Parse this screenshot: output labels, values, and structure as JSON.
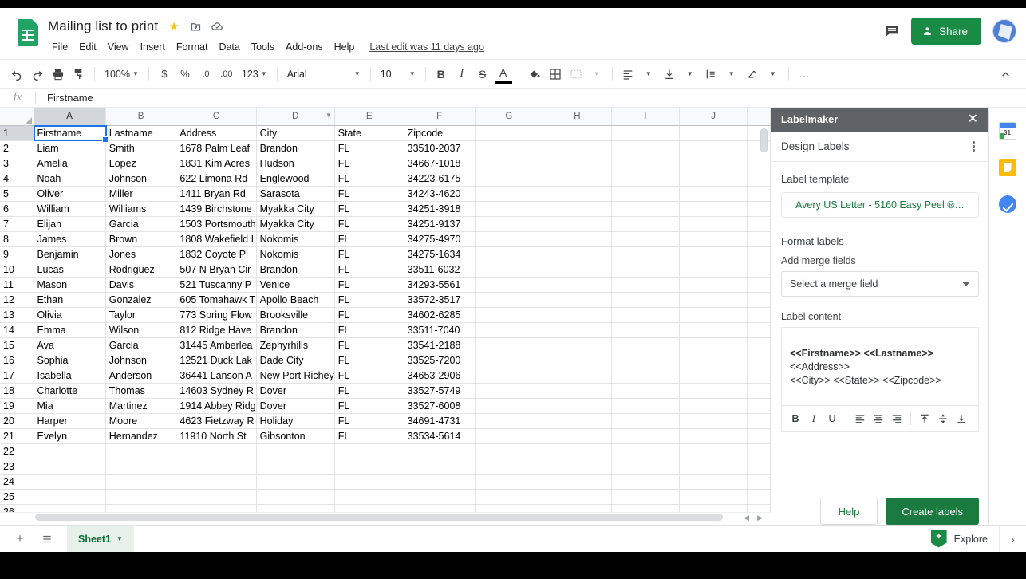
{
  "document": {
    "title": "Mailing list to print",
    "star_icon": "star-icon",
    "move_icon": "move-to-folder-icon",
    "cloud_icon": "cloud-saved-icon",
    "last_edit": "Last edit was 11 days ago"
  },
  "menubar": {
    "items": [
      "File",
      "Edit",
      "View",
      "Insert",
      "Format",
      "Data",
      "Tools",
      "Add-ons",
      "Help"
    ]
  },
  "header_right": {
    "comment_icon": "comment-icon",
    "share_label": "Share",
    "share_icon": "share-person-icon",
    "avatar": "user-avatar"
  },
  "toolbar": {
    "undo": "undo-icon",
    "redo": "redo-icon",
    "print": "print-icon",
    "paint": "paint-format-icon",
    "zoom_value": "100%",
    "currency": "$",
    "percent": "%",
    "decimal_decrease": ".0",
    "decimal_increase": ".00",
    "number_format": "123",
    "font_family": "Arial",
    "font_size": "10",
    "bold": "B",
    "italic": "I",
    "strikethrough": "S",
    "text_color": "A",
    "fill_color": "fill-color-icon",
    "borders": "borders-icon",
    "merge_cells": "merge-cells-icon",
    "halign": "horizontal-align-icon",
    "valign": "vertical-align-icon",
    "text_wrap": "text-wrapping-icon",
    "text_rotation": "text-rotation-icon",
    "more": "…",
    "collapse": "collapse-toolbar-icon"
  },
  "formula_bar": {
    "fx_label": "fx",
    "value": "Firstname"
  },
  "spreadsheet": {
    "selected_cell": "A1",
    "column_headers": [
      "A",
      "B",
      "C",
      "D",
      "E",
      "F",
      "G",
      "H",
      "I",
      "J"
    ],
    "header_row": [
      "Firstname",
      "Lastname",
      "Address",
      "City",
      "State",
      "Zipcode"
    ],
    "rows": [
      {
        "n": "2",
        "cells": [
          "Liam",
          "Smith",
          "1678 Palm Leaf",
          "Brandon",
          "FL",
          "33510-2037"
        ]
      },
      {
        "n": "3",
        "cells": [
          "Amelia",
          "Lopez",
          "1831 Kim Acres",
          "Hudson",
          "FL",
          "34667-1018"
        ]
      },
      {
        "n": "4",
        "cells": [
          "Noah",
          "Johnson",
          "622 Limona Rd",
          "Englewood",
          "FL",
          "34223-6175"
        ]
      },
      {
        "n": "5",
        "cells": [
          "Oliver",
          "Miller",
          "1411 Bryan Rd",
          "Sarasota",
          "FL",
          "34243-4620"
        ]
      },
      {
        "n": "6",
        "cells": [
          "William",
          "Williams",
          "1439 Birchstone",
          "Myakka City",
          "FL",
          "34251-3918"
        ]
      },
      {
        "n": "7",
        "cells": [
          "Elijah",
          "Garcia",
          "1503 Portsmouth",
          "Myakka City",
          "FL",
          "34251-9137"
        ]
      },
      {
        "n": "8",
        "cells": [
          "James",
          "Brown",
          "1808 Wakefield I",
          "Nokomis",
          "FL",
          "34275-4970"
        ]
      },
      {
        "n": "9",
        "cells": [
          "Benjamin",
          "Jones",
          "1832 Coyote Pl",
          "Nokomis",
          "FL",
          "34275-1634"
        ]
      },
      {
        "n": "10",
        "cells": [
          "Lucas",
          "Rodriguez",
          "507 N Bryan Cir",
          "Brandon",
          "FL",
          "33511-6032"
        ]
      },
      {
        "n": "11",
        "cells": [
          "Mason",
          "Davis",
          "521 Tuscanny P",
          "Venice",
          "FL",
          "34293-5561"
        ]
      },
      {
        "n": "12",
        "cells": [
          "Ethan",
          "Gonzalez",
          "605 Tomahawk T",
          "Apollo Beach",
          "FL",
          "33572-3517"
        ]
      },
      {
        "n": "13",
        "cells": [
          "Olivia",
          "Taylor",
          "773 Spring Flow",
          "Brooksville",
          "FL",
          "34602-6285"
        ]
      },
      {
        "n": "14",
        "cells": [
          "Emma",
          "Wilson",
          "812 Ridge Have",
          "Brandon",
          "FL",
          "33511-7040"
        ]
      },
      {
        "n": "15",
        "cells": [
          "Ava",
          "Garcia",
          "31445 Amberlea",
          "Zephyrhills",
          "FL",
          "33541-2188"
        ]
      },
      {
        "n": "16",
        "cells": [
          "Sophia",
          "Johnson",
          "12521 Duck Lak",
          "Dade City",
          "FL",
          "33525-7200"
        ]
      },
      {
        "n": "17",
        "cells": [
          "Isabella",
          "Anderson",
          "36441 Lanson A",
          "New Port Richey",
          "FL",
          "34653-2906"
        ]
      },
      {
        "n": "18",
        "cells": [
          "Charlotte",
          "Thomas",
          "14603 Sydney R",
          "Dover",
          "FL",
          "33527-5749"
        ]
      },
      {
        "n": "19",
        "cells": [
          "Mia",
          "Martinez",
          "1914 Abbey Ridg",
          "Dover",
          "FL",
          "33527-6008"
        ]
      },
      {
        "n": "20",
        "cells": [
          "Harper",
          "Moore",
          "4623 Fietzway R",
          "Holiday",
          "FL",
          "34691-4731"
        ]
      },
      {
        "n": "21",
        "cells": [
          "Evelyn",
          "Hernandez",
          "11910 North St",
          "Gibsonton",
          "FL",
          "33534-5614"
        ]
      },
      {
        "n": "22",
        "cells": [
          "",
          "",
          "",
          "",
          "",
          ""
        ]
      },
      {
        "n": "23",
        "cells": [
          "",
          "",
          "",
          "",
          "",
          ""
        ]
      },
      {
        "n": "24",
        "cells": [
          "",
          "",
          "",
          "",
          "",
          ""
        ]
      },
      {
        "n": "25",
        "cells": [
          "",
          "",
          "",
          "",
          "",
          ""
        ]
      },
      {
        "n": "26",
        "cells": [
          "",
          "",
          "",
          "",
          "",
          ""
        ]
      },
      {
        "n": "27",
        "cells": [
          "",
          "",
          "",
          "",
          "",
          ""
        ]
      },
      {
        "n": "28",
        "cells": [
          "",
          "",
          "",
          "",
          "",
          ""
        ]
      }
    ]
  },
  "sidebar": {
    "title": "Labelmaker",
    "close_icon": "close-icon",
    "subtitle": "Design Labels",
    "menu_icon": "kebab-menu-icon",
    "label_template_heading": "Label template",
    "label_template_value": "Avery US Letter - 5160 Easy Peel ®…",
    "format_labels_heading": "Format labels",
    "add_merge_fields_heading": "Add merge fields",
    "merge_field_value": "Select a merge field",
    "label_content_heading": "Label content",
    "label_content_lines": [
      "<<Firstname>> <<Lastname>>",
      "<<Address>>",
      "<<City>> <<State>> <<Zipcode>>"
    ],
    "content_toolbar": {
      "bold": "B",
      "italic": "I",
      "underline": "U",
      "align_left": "align-left-icon",
      "align_center": "align-center-icon",
      "align_right": "align-right-icon",
      "align_top": "align-top-icon",
      "align_middle": "align-middle-icon",
      "align_bottom": "align-bottom-icon"
    },
    "help_label": "Help",
    "create_labels_label": "Create labels"
  },
  "rail": {
    "items": [
      "calendar-icon",
      "keep-icon",
      "tasks-icon"
    ]
  },
  "footer": {
    "add_sheet_icon": "add-sheet-icon",
    "all_sheets_icon": "all-sheets-icon",
    "sheet_tab_name": "Sheet1",
    "sheet_tab_caret": "chevron-down-icon",
    "explore_label": "Explore",
    "expand_icon": "chevron-right-icon"
  },
  "colors": {
    "brand_green": "#1a8b45",
    "sidebar_header": "#5f6368",
    "accent_blue": "#1a73e8",
    "template_green": "#1a7a3f"
  }
}
